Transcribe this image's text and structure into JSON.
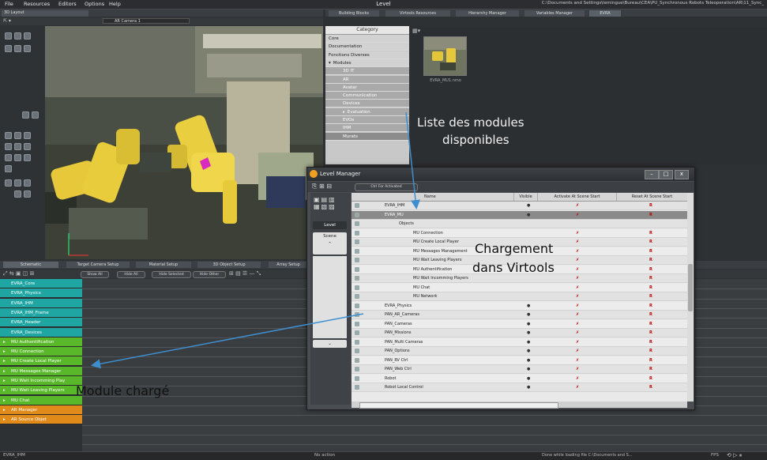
{
  "menubar": {
    "items": [
      "File",
      "Resources",
      "Editors",
      "Options",
      "Help"
    ],
    "title": "Level",
    "path": "C:\\Documents and Settings\\lemingue\\Bureau\\CEA\\PU_Synchronous Robots Teleoperation\\AR\\11_Sync_"
  },
  "viewport": {
    "tab_label": "3D Layout",
    "camera": "AR Camera 1"
  },
  "right_tabs": [
    "Building Blocks",
    "Virtools Resources",
    "Hierarchy Manager",
    "Variables Manager",
    "EVRA"
  ],
  "category": {
    "header": "Category",
    "items": [
      {
        "label": "Core",
        "indent": 0,
        "expander": ""
      },
      {
        "label": "Documentation",
        "indent": 0,
        "expander": ""
      },
      {
        "label": "Fonctions Diverses",
        "indent": 0,
        "expander": ""
      },
      {
        "label": "Modules",
        "indent": 0,
        "expander": "▾"
      },
      {
        "label": "3D IT",
        "indent": 1,
        "expander": ""
      },
      {
        "label": "AR",
        "indent": 1,
        "expander": ""
      },
      {
        "label": "Avatar",
        "indent": 1,
        "expander": ""
      },
      {
        "label": "Communication",
        "indent": 1,
        "expander": ""
      },
      {
        "label": "Devices",
        "indent": 1,
        "expander": ""
      },
      {
        "label": "Evaluation",
        "indent": 1,
        "expander": "▸"
      },
      {
        "label": "EVOs",
        "indent": 1,
        "expander": ""
      },
      {
        "label": "IHM",
        "indent": 1,
        "expander": ""
      },
      {
        "label": "Murats",
        "indent": 1,
        "expander": ""
      }
    ]
  },
  "preview": {
    "label": "EVRA_MU1.nmo"
  },
  "schematic": {
    "tabs": [
      "Schematic",
      "Target Camera Setup",
      "Material Setup",
      "3D Object Setup",
      "Array Setup"
    ],
    "buttons": [
      "Show All",
      "Hide All",
      "Hide Selected",
      "Hide Other"
    ],
    "rows": [
      {
        "label": "EVRA_Core",
        "color": "#1fa6a3"
      },
      {
        "label": "EVRA_Physics",
        "color": "#1fa6a3"
      },
      {
        "label": "EVRA_IHM",
        "color": "#1fa6a3"
      },
      {
        "label": "EVRA_IHM_Frame",
        "color": "#1fa6a3"
      },
      {
        "label": "EVRA_Header",
        "color": "#1fa6a3"
      },
      {
        "label": "EVRA_Devices",
        "color": "#1fa6a3"
      },
      {
        "label": "MU Authentification",
        "color": "#58b82a"
      },
      {
        "label": "MU Connection",
        "color": "#58b82a"
      },
      {
        "label": "MU Create Local Player",
        "color": "#58b82a"
      },
      {
        "label": "MU Messages Manager",
        "color": "#58b82a"
      },
      {
        "label": "MU Wait Incomming Play",
        "color": "#58b82a"
      },
      {
        "label": "MU Wait Leaving Players",
        "color": "#58b82a"
      },
      {
        "label": "MU Chat",
        "color": "#58b82a"
      },
      {
        "label": "AR Manager",
        "color": "#e08a1a"
      },
      {
        "label": "AR Source Objet",
        "color": "#e08a1a"
      }
    ]
  },
  "level_manager": {
    "title": "Level Manager",
    "toolbar_button": "Ctrl For Activated",
    "side_tabs": [
      "Level",
      "Scene"
    ],
    "columns": [
      "Name",
      "Visible",
      "Activate At Scene Start",
      "Reset At Scene Start"
    ],
    "rows": [
      {
        "name": "EVRA_IHM",
        "indent": 1,
        "visible": "●",
        "activate": "✗",
        "reset": "R",
        "selected": false
      },
      {
        "name": "EVRA_MU",
        "indent": 1,
        "visible": "●",
        "activate": "✗",
        "reset": "R",
        "selected": true
      },
      {
        "name": "Objects",
        "indent": 2,
        "visible": "",
        "activate": "",
        "reset": "",
        "selected": false
      },
      {
        "name": "MU Connection",
        "indent": 3,
        "visible": "",
        "activate": "✗",
        "reset": "R",
        "selected": false
      },
      {
        "name": "MU Create Local Player",
        "indent": 3,
        "visible": "",
        "activate": "✗",
        "reset": "R",
        "selected": false
      },
      {
        "name": "MU Messages Management",
        "indent": 3,
        "visible": "",
        "activate": "✗",
        "reset": "R",
        "selected": false
      },
      {
        "name": "MU Wait Leaving Players",
        "indent": 3,
        "visible": "",
        "activate": "✗",
        "reset": "R",
        "selected": false
      },
      {
        "name": "MU Authentification",
        "indent": 3,
        "visible": "",
        "activate": "✗",
        "reset": "R",
        "selected": false
      },
      {
        "name": "MU Wait Incomming Players",
        "indent": 3,
        "visible": "",
        "activate": "✗",
        "reset": "R",
        "selected": false
      },
      {
        "name": "MU Chat",
        "indent": 3,
        "visible": "",
        "activate": "✗",
        "reset": "R",
        "selected": false
      },
      {
        "name": "MU Network",
        "indent": 3,
        "visible": "",
        "activate": "✗",
        "reset": "R",
        "selected": false
      },
      {
        "name": "EVRA_Physics",
        "indent": 1,
        "visible": "●",
        "activate": "✗",
        "reset": "R",
        "selected": false
      },
      {
        "name": "PAN_AR_Cameras",
        "indent": 1,
        "visible": "●",
        "activate": "✗",
        "reset": "R",
        "selected": false
      },
      {
        "name": "PAN_Cameras",
        "indent": 1,
        "visible": "●",
        "activate": "✗",
        "reset": "R",
        "selected": false
      },
      {
        "name": "PAN_Missions",
        "indent": 1,
        "visible": "●",
        "activate": "✗",
        "reset": "R",
        "selected": false
      },
      {
        "name": "PAN_Multi Cameras",
        "indent": 1,
        "visible": "●",
        "activate": "✗",
        "reset": "R",
        "selected": false
      },
      {
        "name": "PAN_Options",
        "indent": 1,
        "visible": "●",
        "activate": "✗",
        "reset": "R",
        "selected": false
      },
      {
        "name": "PAN_RV Ctrl",
        "indent": 1,
        "visible": "●",
        "activate": "✗",
        "reset": "R",
        "selected": false
      },
      {
        "name": "PAN_Web Ctrl",
        "indent": 1,
        "visible": "●",
        "activate": "✗",
        "reset": "R",
        "selected": false
      },
      {
        "name": "Robot",
        "indent": 1,
        "visible": "●",
        "activate": "✗",
        "reset": "R",
        "selected": false
      },
      {
        "name": "Robot Local Control",
        "indent": 1,
        "visible": "●",
        "activate": "✗",
        "reset": "R",
        "selected": false
      }
    ]
  },
  "annotations": {
    "modules_line1": "Liste des modules",
    "modules_line2": "disponibles",
    "loading_line1": "Chargement",
    "loading_line2": "dans Virtools",
    "loaded": "Module chargé"
  },
  "statusbar": {
    "left": "EVRA_IHM",
    "center": "No action",
    "right": "Done while loading file C:\\Documents and S...",
    "fps_label": "FPS"
  },
  "colors": {
    "annotation_arrow": "#3f8fd0",
    "teal_row": "#1fa6a3",
    "green_row": "#58b82a",
    "orange_row": "#e08a1a"
  }
}
